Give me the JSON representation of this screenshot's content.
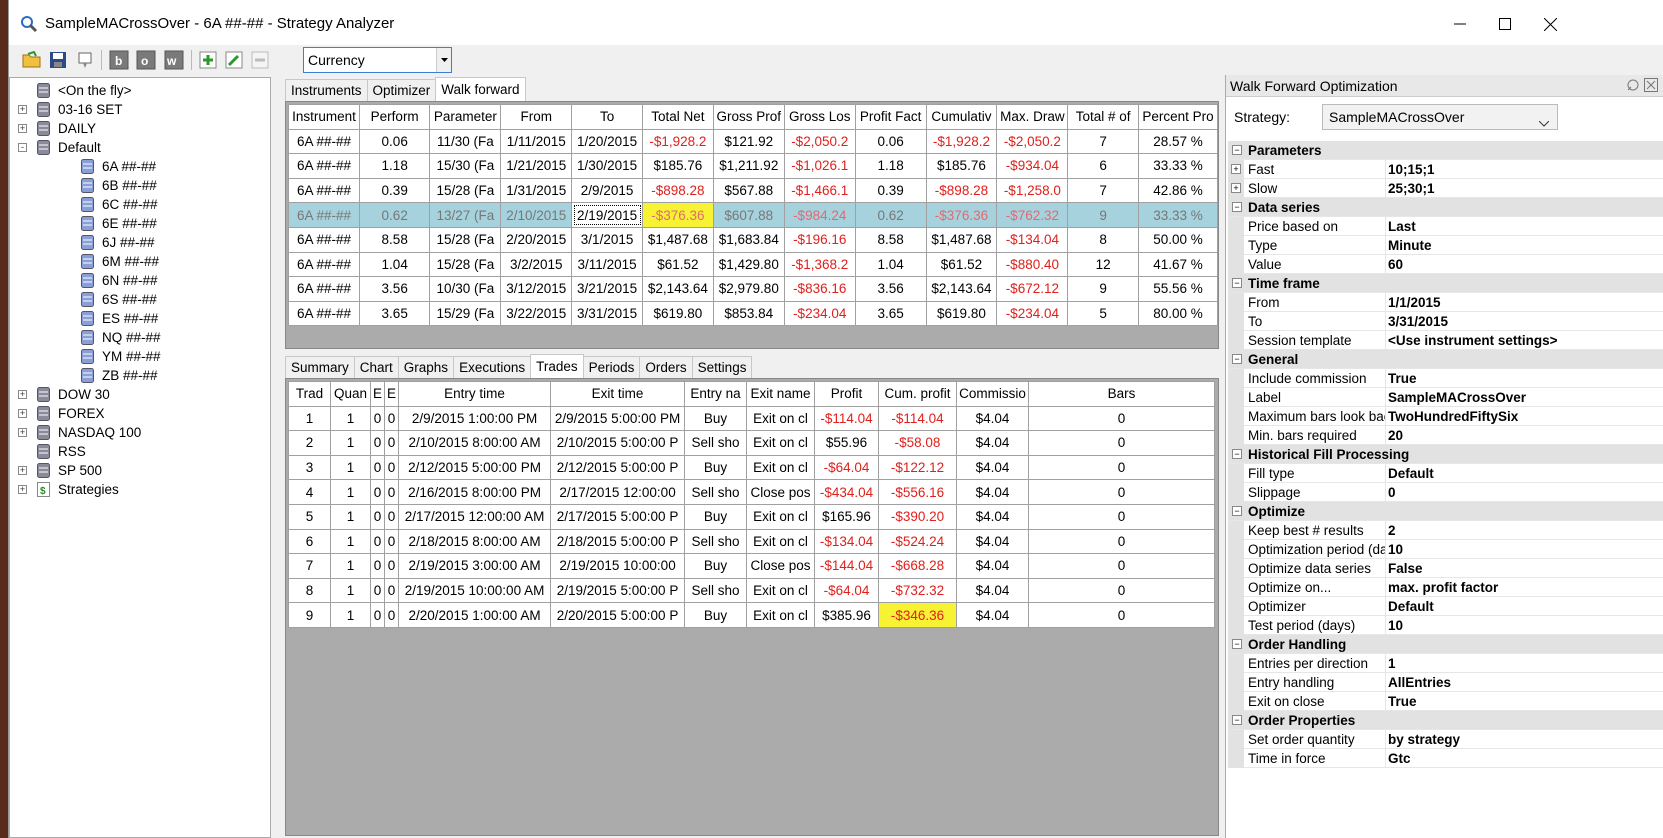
{
  "window": {
    "title": "SampleMACrossOver - 6A ##-## - Strategy Analyzer"
  },
  "toolbar": {
    "combo_value": "Currency"
  },
  "tree": [
    {
      "label": "<On the fly>",
      "indent": 1,
      "exp": ""
    },
    {
      "label": "03-16 SET",
      "indent": 1,
      "exp": "+"
    },
    {
      "label": "DAILY",
      "indent": 1,
      "exp": "+"
    },
    {
      "label": "Default",
      "indent": 1,
      "exp": "-"
    },
    {
      "label": "6A ##-##",
      "indent": 2,
      "exp": ""
    },
    {
      "label": "6B ##-##",
      "indent": 2,
      "exp": ""
    },
    {
      "label": "6C ##-##",
      "indent": 2,
      "exp": ""
    },
    {
      "label": "6E ##-##",
      "indent": 2,
      "exp": ""
    },
    {
      "label": "6J ##-##",
      "indent": 2,
      "exp": ""
    },
    {
      "label": "6M ##-##",
      "indent": 2,
      "exp": ""
    },
    {
      "label": "6N ##-##",
      "indent": 2,
      "exp": ""
    },
    {
      "label": "6S ##-##",
      "indent": 2,
      "exp": ""
    },
    {
      "label": "ES ##-##",
      "indent": 2,
      "exp": ""
    },
    {
      "label": "NQ ##-##",
      "indent": 2,
      "exp": ""
    },
    {
      "label": "YM ##-##",
      "indent": 2,
      "exp": ""
    },
    {
      "label": "ZB ##-##",
      "indent": 2,
      "exp": ""
    },
    {
      "label": "DOW 30",
      "indent": 1,
      "exp": "+"
    },
    {
      "label": "FOREX",
      "indent": 1,
      "exp": "+"
    },
    {
      "label": "NASDAQ 100",
      "indent": 1,
      "exp": "+"
    },
    {
      "label": "RSS",
      "indent": 1,
      "exp": ""
    },
    {
      "label": "SP 500",
      "indent": 1,
      "exp": "+"
    },
    {
      "label": "Strategies",
      "indent": 1,
      "exp": "+",
      "strategy": true
    }
  ],
  "top_tabs": [
    "Instruments",
    "Optimizer",
    "Walk forward"
  ],
  "wf_headers": [
    "Instrument",
    "Perform",
    "Parameter",
    "From",
    "To",
    "Total Net",
    "Gross Prof",
    "Gross Los",
    "Profit Fact",
    "Cumulativ",
    "Max. Draw",
    "Total # of",
    "Percent Pro"
  ],
  "wf_rows": [
    [
      "6A ##-##",
      "0.06",
      "11/30 (Fa",
      "1/11/2015",
      "1/20/2015",
      "-$1,928.2",
      "$121.92",
      "-$2,050.2",
      "0.06",
      "-$1,928.2",
      "-$2,050.2",
      "7",
      "28.57 %"
    ],
    [
      "6A ##-##",
      "1.18",
      "15/30 (Fa",
      "1/21/2015",
      "1/30/2015",
      "$185.76",
      "$1,211.92",
      "-$1,026.1",
      "1.18",
      "$185.76",
      "-$934.04",
      "6",
      "33.33 %"
    ],
    [
      "6A ##-##",
      "0.39",
      "15/28 (Fa",
      "1/31/2015",
      "2/9/2015",
      "-$898.28",
      "$567.88",
      "-$1,466.1",
      "0.39",
      "-$898.28",
      "-$1,258.0",
      "7",
      "42.86 %"
    ],
    [
      "6A ##-##",
      "0.62",
      "13/27 (Fa",
      "2/10/2015",
      "2/19/2015",
      "-$376.36",
      "$607.88",
      "-$984.24",
      "0.62",
      "-$376.36",
      "-$762.32",
      "9",
      "33.33 %"
    ],
    [
      "6A ##-##",
      "8.58",
      "15/28 (Fa",
      "2/20/2015",
      "3/1/2015",
      "$1,487.68",
      "$1,683.84",
      "-$196.16",
      "8.58",
      "$1,487.68",
      "-$134.04",
      "8",
      "50.00 %"
    ],
    [
      "6A ##-##",
      "1.04",
      "15/28 (Fa",
      "3/2/2015",
      "3/11/2015",
      "$61.52",
      "$1,429.80",
      "-$1,368.2",
      "1.04",
      "$61.52",
      "-$880.40",
      "12",
      "41.67 %"
    ],
    [
      "6A ##-##",
      "3.56",
      "10/30 (Fa",
      "3/12/2015",
      "3/21/2015",
      "$2,143.64",
      "$2,979.80",
      "-$836.16",
      "3.56",
      "$2,143.64",
      "-$672.12",
      "9",
      "55.56 %"
    ],
    [
      "6A ##-##",
      "3.65",
      "15/29 (Fa",
      "3/22/2015",
      "3/31/2015",
      "$619.80",
      "$853.84",
      "-$234.04",
      "3.65",
      "$619.80",
      "-$234.04",
      "5",
      "80.00 %"
    ]
  ],
  "bottom_tabs": [
    "Summary",
    "Chart",
    "Graphs",
    "Executions",
    "Trades",
    "Periods",
    "Orders",
    "Settings"
  ],
  "tr_headers": [
    "Trad",
    "Quan",
    "E",
    "E",
    "Entry time",
    "Exit time",
    "Entry na",
    "Exit name",
    "Profit",
    "Cum. profit",
    "Commissio",
    "Bars"
  ],
  "tr_rows": [
    [
      "1",
      "1",
      "0",
      "0",
      "2/9/2015 1:00:00 PM",
      "2/9/2015 5:00:00 PM",
      "Buy",
      "Exit on cl",
      "-$114.04",
      "-$114.04",
      "$4.04",
      "0"
    ],
    [
      "2",
      "1",
      "0",
      "0",
      "2/10/2015 8:00:00 AM",
      "2/10/2015 5:00:00 P",
      "Sell sho",
      "Exit on cl",
      "$55.96",
      "-$58.08",
      "$4.04",
      "0"
    ],
    [
      "3",
      "1",
      "0",
      "0",
      "2/12/2015 5:00:00 PM",
      "2/12/2015 5:00:00 P",
      "Buy",
      "Exit on cl",
      "-$64.04",
      "-$122.12",
      "$4.04",
      "0"
    ],
    [
      "4",
      "1",
      "0",
      "0",
      "2/16/2015 8:00:00 PM",
      "2/17/2015 12:00:00",
      "Sell sho",
      "Close pos",
      "-$434.04",
      "-$556.16",
      "$4.04",
      "0"
    ],
    [
      "5",
      "1",
      "0",
      "0",
      "2/17/2015 12:00:00 AM",
      "2/17/2015 5:00:00 P",
      "Buy",
      "Exit on cl",
      "$165.96",
      "-$390.20",
      "$4.04",
      "0"
    ],
    [
      "6",
      "1",
      "0",
      "0",
      "2/18/2015 8:00:00 AM",
      "2/18/2015 5:00:00 P",
      "Sell sho",
      "Exit on cl",
      "-$134.04",
      "-$524.24",
      "$4.04",
      "0"
    ],
    [
      "7",
      "1",
      "0",
      "0",
      "2/19/2015 3:00:00 AM",
      "2/19/2015 10:00:00",
      "Buy",
      "Close pos",
      "-$144.04",
      "-$668.28",
      "$4.04",
      "0"
    ],
    [
      "8",
      "1",
      "0",
      "0",
      "2/19/2015 10:00:00 AM",
      "2/19/2015 5:00:00 P",
      "Sell sho",
      "Exit on cl",
      "-$64.04",
      "-$732.32",
      "$4.04",
      "0"
    ],
    [
      "9",
      "1",
      "0",
      "0",
      "2/20/2015 1:00:00 AM",
      "2/20/2015 5:00:00 P",
      "Buy",
      "Exit on cl",
      "$385.96",
      "-$346.36",
      "$4.04",
      "0"
    ]
  ],
  "right": {
    "header": "Walk Forward Optimization",
    "strategy_label": "Strategy:",
    "strategy_value": "SampleMACrossOver",
    "props": [
      {
        "cat": "Parameters"
      },
      {
        "name": "Fast",
        "value": "10;15;1",
        "expand": true
      },
      {
        "name": "Slow",
        "value": "25;30;1",
        "expand": true
      },
      {
        "cat": "Data series"
      },
      {
        "name": "Price based on",
        "value": "Last"
      },
      {
        "name": "Type",
        "value": "Minute"
      },
      {
        "name": "Value",
        "value": "60"
      },
      {
        "cat": "Time frame"
      },
      {
        "name": "From",
        "value": "1/1/2015"
      },
      {
        "name": "To",
        "value": "3/31/2015"
      },
      {
        "name": "Session template",
        "value": "<Use instrument settings>"
      },
      {
        "cat": "General"
      },
      {
        "name": "Include commission",
        "value": "True"
      },
      {
        "name": "Label",
        "value": "SampleMACrossOver"
      },
      {
        "name": "Maximum bars look bac",
        "value": "TwoHundredFiftySix"
      },
      {
        "name": "Min. bars required",
        "value": "20"
      },
      {
        "cat": "Historical Fill Processing"
      },
      {
        "name": "Fill type",
        "value": "Default"
      },
      {
        "name": "Slippage",
        "value": "0"
      },
      {
        "cat": "Optimize"
      },
      {
        "name": "Keep best # results",
        "value": "2"
      },
      {
        "name": "Optimization period (da",
        "value": "10"
      },
      {
        "name": "Optimize data series",
        "value": "False"
      },
      {
        "name": "Optimize on...",
        "value": "max. profit factor"
      },
      {
        "name": "Optimizer",
        "value": "Default"
      },
      {
        "name": "Test period (days)",
        "value": "10"
      },
      {
        "cat": "Order Handling"
      },
      {
        "name": "Entries per direction",
        "value": "1"
      },
      {
        "name": "Entry handling",
        "value": "AllEntries"
      },
      {
        "name": "Exit on close",
        "value": "True"
      },
      {
        "cat": "Order Properties"
      },
      {
        "name": "Set order quantity",
        "value": "by strategy"
      },
      {
        "name": "Time in force",
        "value": "Gtc"
      }
    ]
  }
}
